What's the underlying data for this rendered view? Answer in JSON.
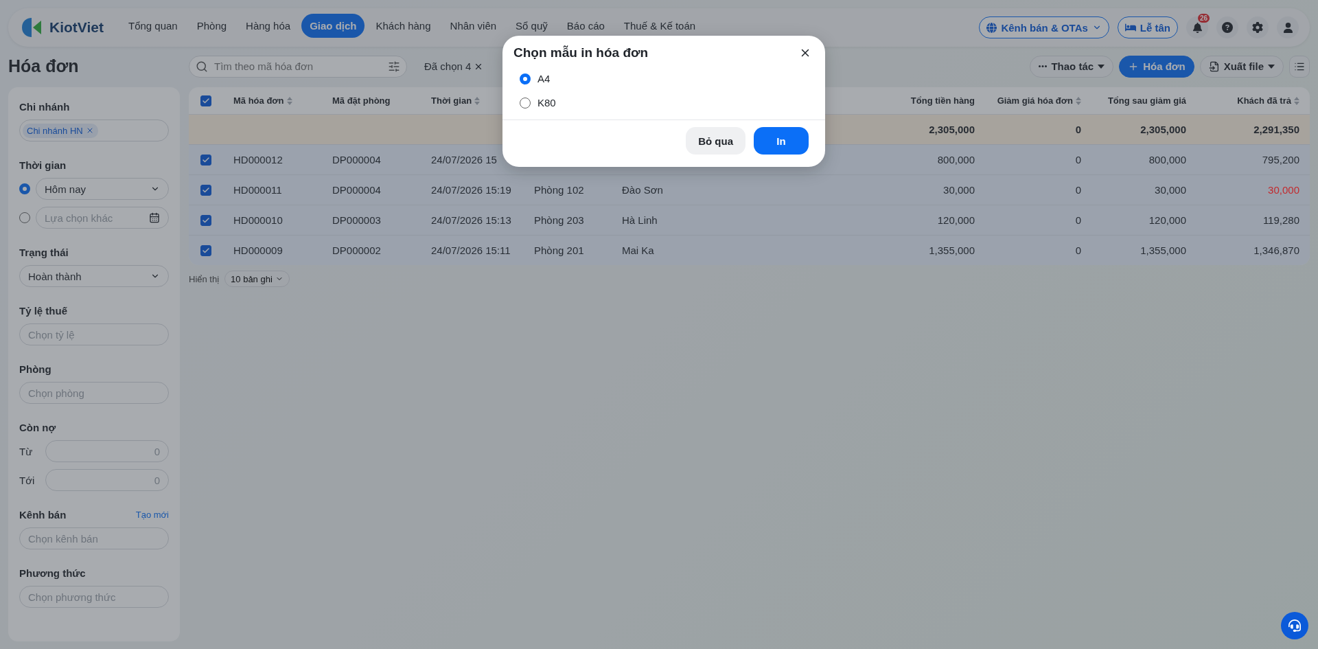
{
  "nav": {
    "logo": "KiotViet",
    "items": [
      {
        "label": "Tổng quan",
        "selected": false
      },
      {
        "label": "Phòng",
        "selected": false
      },
      {
        "label": "Hàng hóa",
        "selected": false
      },
      {
        "label": "Giao dịch",
        "selected": true
      },
      {
        "label": "Khách hàng",
        "selected": false
      },
      {
        "label": "Nhân viên",
        "selected": false
      },
      {
        "label": "Sổ quỹ",
        "selected": false
      },
      {
        "label": "Báo cáo",
        "selected": false
      },
      {
        "label": "Thuế & Kế toán",
        "selected": false
      }
    ],
    "channel_button": "Kênh bán & OTAs",
    "reception_button": "Lễ tân",
    "notification_count": "26"
  },
  "page_title": "Hóa đơn",
  "search": {
    "placeholder": "Tìm theo mã hóa đơn"
  },
  "selection": "Đã chọn 4",
  "actions": [
    {
      "kind": "menu",
      "label": "Thao tác"
    },
    {
      "kind": "primary",
      "label": "Hóa đơn"
    },
    {
      "kind": "export",
      "label": "Xuất file"
    }
  ],
  "filters": [
    {
      "kind": "tags",
      "label": "Chi nhánh",
      "tags": [
        "Chi nhánh HN"
      ]
    },
    {
      "kind": "time",
      "label": "Thời gian",
      "options": [
        {
          "kind": "select",
          "value": "Hôm nay",
          "selected": true
        },
        {
          "kind": "date",
          "placeholder": "Lựa chọn khác",
          "selected": false
        }
      ]
    },
    {
      "kind": "select",
      "label": "Trạng thái",
      "value": "Hoàn thành"
    },
    {
      "kind": "input",
      "label": "Tỷ lệ thuế",
      "placeholder": "Chọn tỷ lệ"
    },
    {
      "kind": "input",
      "label": "Phòng",
      "placeholder": "Chọn phòng"
    },
    {
      "kind": "range",
      "label": "Còn nợ",
      "rows": [
        {
          "label": "Từ",
          "placeholder": "0"
        },
        {
          "label": "Tới",
          "placeholder": "0"
        }
      ]
    },
    {
      "kind": "input",
      "label": "Kênh bán",
      "link": "Tạo mới",
      "placeholder": "Chọn kênh bán"
    },
    {
      "kind": "input",
      "label": "Phương thức",
      "placeholder": "Chọn phương thức"
    }
  ],
  "table": {
    "all_checked": true,
    "columns": [
      {
        "label": "Mã hóa đơn",
        "sortable": true
      },
      {
        "label": "Mã đặt phòng",
        "sortable": false
      },
      {
        "label": "Thời gian",
        "sortable": true
      },
      {
        "label": "Tổng tiền hàng",
        "sortable": false
      },
      {
        "label": "Giảm giá hóa đơn",
        "sortable": true
      },
      {
        "label": "Tổng sau giảm giá",
        "sortable": false
      },
      {
        "label": "Khách đã trả",
        "sortable": true
      }
    ],
    "summary": {
      "total": "2,305,000",
      "discount": "0",
      "after_discount": "2,305,000",
      "paid": "2,291,350"
    },
    "rows": [
      {
        "checked": true,
        "invoice": "HD000012",
        "booking": "DP000004",
        "time": "24/07/2026 15",
        "total": "800,000",
        "discount": "0",
        "after_discount": "800,000",
        "paid": "795,200"
      },
      {
        "checked": true,
        "invoice": "HD000011",
        "booking": "DP000004",
        "time": "24/07/2026 15:19",
        "column_5": "Phòng 102",
        "column_6": "Đào Sơn",
        "total": "30,000",
        "discount": "0",
        "after_discount": "30,000",
        "paid": "30,000",
        "color": "#c22a2e"
      },
      {
        "checked": true,
        "invoice": "HD000010",
        "booking": "DP000003",
        "time": "24/07/2026 15:13",
        "column_5": "Phòng 203",
        "column_6": "Hà Linh",
        "total": "120,000",
        "discount": "0",
        "after_discount": "120,000",
        "paid": "119,280"
      },
      {
        "checked": true,
        "invoice": "HD000009",
        "booking": "DP000002",
        "time": "24/07/2026 15:11",
        "column_5": "Phòng 201",
        "column_6": "Mai Ka",
        "total": "1,355,000",
        "discount": "0",
        "after_discount": "1,355,000",
        "paid": "1,346,870"
      }
    ]
  },
  "pager": {
    "label": "Hiển thị",
    "page_size": "10 bản ghi"
  },
  "dialog": {
    "title": "Chọn mẫu in hóa đơn",
    "options": [
      {
        "label": "A4",
        "selected": true
      },
      {
        "label": "K80",
        "selected": false
      }
    ],
    "buttons": [
      {
        "kind": "secondary",
        "label": "Bỏ qua"
      },
      {
        "kind": "primary",
        "label": "In"
      }
    ]
  }
}
